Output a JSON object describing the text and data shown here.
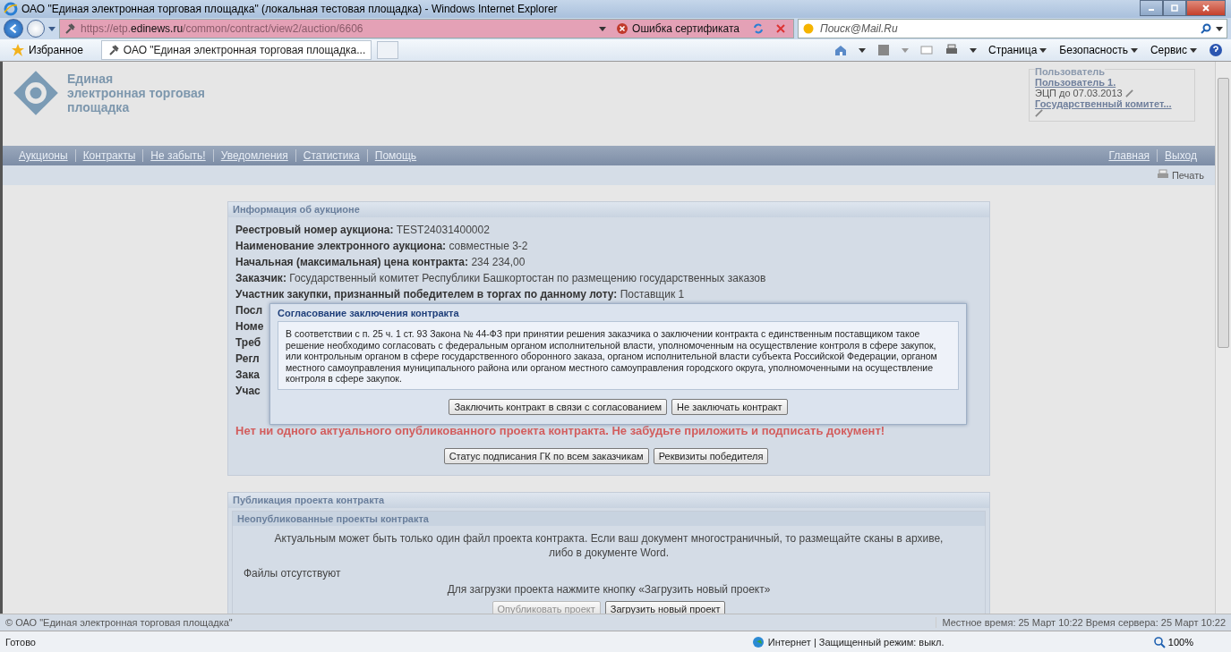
{
  "window": {
    "title": "ОАО \"Единая электронная торговая площадка\" (локальная тестовая площадка) - Windows Internet Explorer"
  },
  "address_bar": {
    "url": "https://etp.**edinews.ru**/common/contract/view2/auction/6606",
    "certificate_error": "Ошибка сертификата",
    "search_placeholder": "Поиск@Mail.Ru"
  },
  "favorites_bar": {
    "favorites": "Избранное",
    "tabs": [
      {
        "label": "ОАО \"Единая электронная торговая площадка...",
        "selected": true
      }
    ],
    "menus": [
      "Страница",
      "Безопасность",
      "Сервис"
    ]
  },
  "site_header": {
    "logo_text": [
      "Единая",
      "электронная торговая",
      "площадка"
    ],
    "user": {
      "legend": "Пользователь",
      "name": "Пользователь 1.",
      "signature": "ЭЦП до 07.03.2013",
      "organization": "Государственный комитет..."
    }
  },
  "nav": {
    "left": [
      "Аукционы",
      "Контракты",
      "Не забыть!",
      "Уведомления",
      "Статистика",
      "Помощь"
    ],
    "right": [
      "Главная",
      "Выход"
    ]
  },
  "print": "Печать",
  "auction_panel": {
    "title": "Информация об аукционе",
    "rows": [
      {
        "kind": "full",
        "label": "Реестровый номер аукциона:",
        "value": "TEST24031400002"
      },
      {
        "kind": "full",
        "label": "Наименование электронного аукциона:",
        "value": "совместные 3-2"
      },
      {
        "kind": "full",
        "label": "Начальная (максимальная) цена контракта:",
        "value": "234 234,00"
      },
      {
        "kind": "full",
        "label": "Заказчик:",
        "value": "Государственный комитет Республики Башкортостан по размещению государственных заказов"
      },
      {
        "kind": "full",
        "label": "Участник закупки, признанный победителем в торгах по данному лоту:",
        "value": "Поставщик 1"
      },
      {
        "kind": "covered",
        "label": "Посл"
      },
      {
        "kind": "covered",
        "label": "Номе"
      },
      {
        "kind": "covered",
        "label": "Треб"
      },
      {
        "kind": "covered",
        "label": "Регл"
      },
      {
        "kind": "covered",
        "label": "Зака"
      },
      {
        "kind": "covered",
        "label": "Учас"
      }
    ],
    "warning": "Нет ни одного актуального опубликованного проекта контракта. Не забудьте приложить и подписать документ!",
    "buttons": [
      "Статус подписания ГК по всем заказчикам",
      "Реквизиты победителя"
    ]
  },
  "dialog": {
    "title": "Согласование заключения контракта",
    "text": "В соответствии с п. 25 ч. 1 ст. 93 Закона № 44-ФЗ при принятии решения заказчика о заключении контракта с единственным поставщиком такое решение необходимо согласовать с федеральным органом исполнительной власти, уполномоченным на осуществление контроля в сфере закупок, или контрольным органом в сфере государственного оборонного заказа, органом исполнительной власти субъекта Российской Федерации, органом местного самоуправления муниципального района или органом местного самоуправления городского округа, уполномоченными на осуществление контроля в сфере закупок.",
    "buttons": [
      "Заключить контракт в связи с согласованием",
      "Не заключать контракт"
    ]
  },
  "publication_panel": {
    "title": "Публикация проекта контракта",
    "subtitle": "Неопубликованные проекты контракта",
    "note": "Актуальным может быть только один файл проекта контракта. Если ваш документ многостраничный, то размещайте сканы в архиве, либо в документе Word.",
    "files": "Файлы отсутствуют",
    "hint": "Для загрузки проекта нажмите кнопку «Загрузить новый проект»",
    "buttons": [
      {
        "label": "Опубликовать проект",
        "disabled": true
      },
      {
        "label": "Загрузить новый проект",
        "disabled": false
      }
    ]
  },
  "site_footer": {
    "copyright": "© ОАО \"Единая электронная торговая площадка\"",
    "time": "Местное время: 25 Март 10:22 Время сервера: 25 Март 10:22"
  },
  "status_bar": {
    "status": "Готово",
    "zone": "Интернет | Защищенный режим: выкл.",
    "zoom": "100%"
  }
}
